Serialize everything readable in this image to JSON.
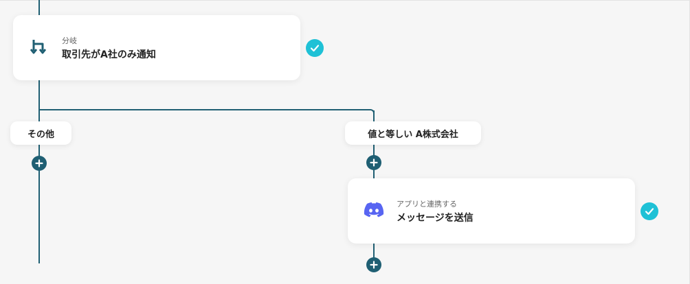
{
  "branch_card": {
    "subtitle": "分岐",
    "title": "取引先がA社のみ通知",
    "icon": "branch-icon"
  },
  "branches": {
    "left_label": "その他",
    "right_label": "値と等しい A株式会社"
  },
  "action_card": {
    "subtitle": "アプリと連携する",
    "title": "メッセージを送信",
    "icon": "discord-icon"
  },
  "colors": {
    "connector": "#1f5f73",
    "check": "#1fc1d6",
    "discord": "#5865f2"
  }
}
